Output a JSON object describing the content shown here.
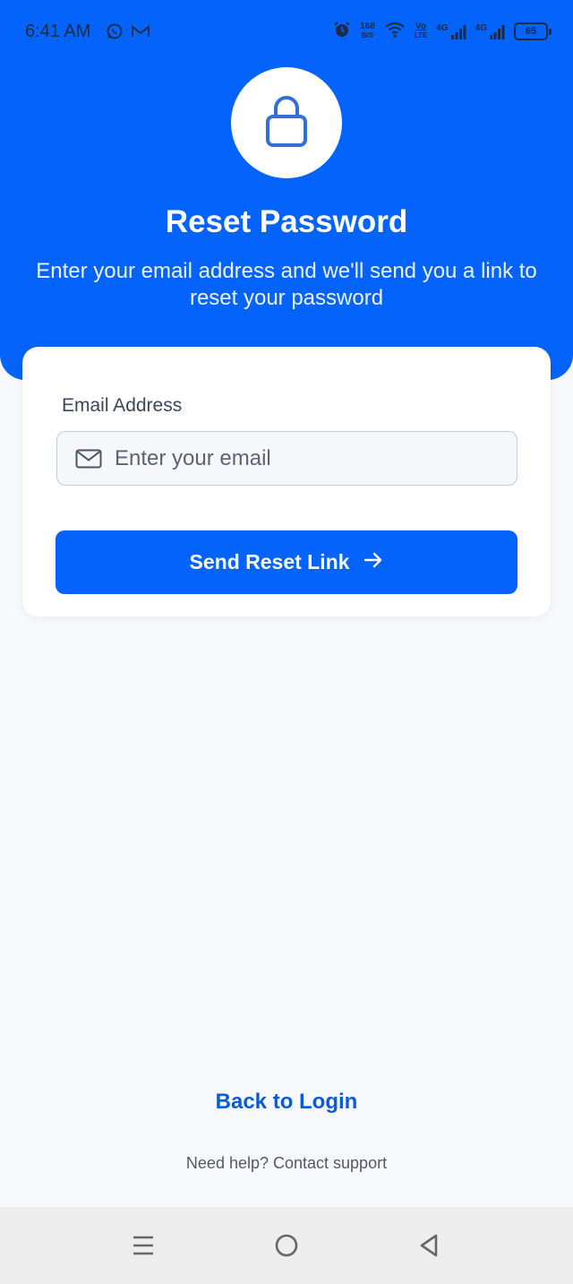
{
  "status_bar": {
    "time": "6:41 AM",
    "net_speed_value": "168",
    "net_speed_unit": "B/S",
    "volte_top": "Vo",
    "volte_bottom": "LTE",
    "sim1_label": "4G",
    "sim2_label": "4G",
    "battery_level": "65",
    "icons": [
      "whatsapp-icon",
      "gmail-icon",
      "alarm-icon",
      "wifi-icon",
      "signal-icon",
      "battery-icon"
    ]
  },
  "header": {
    "icon": "lock-icon",
    "title": "Reset Password",
    "subtitle": "Enter your email address and we'll send you a link to reset your password"
  },
  "form": {
    "email_label": "Email Address",
    "email_placeholder": "Enter your email",
    "email_value": "",
    "submit_label": "Send Reset Link",
    "submit_icon": "arrow-right-icon"
  },
  "footer": {
    "back_link": "Back to Login",
    "help_text": "Need help? Contact support"
  },
  "nav_bar": {
    "icons": [
      "menu-icon",
      "home-icon",
      "back-icon"
    ]
  },
  "colors": {
    "primary": "#0363fa",
    "background": "#f6f8fb",
    "link": "#0a5bd6"
  }
}
